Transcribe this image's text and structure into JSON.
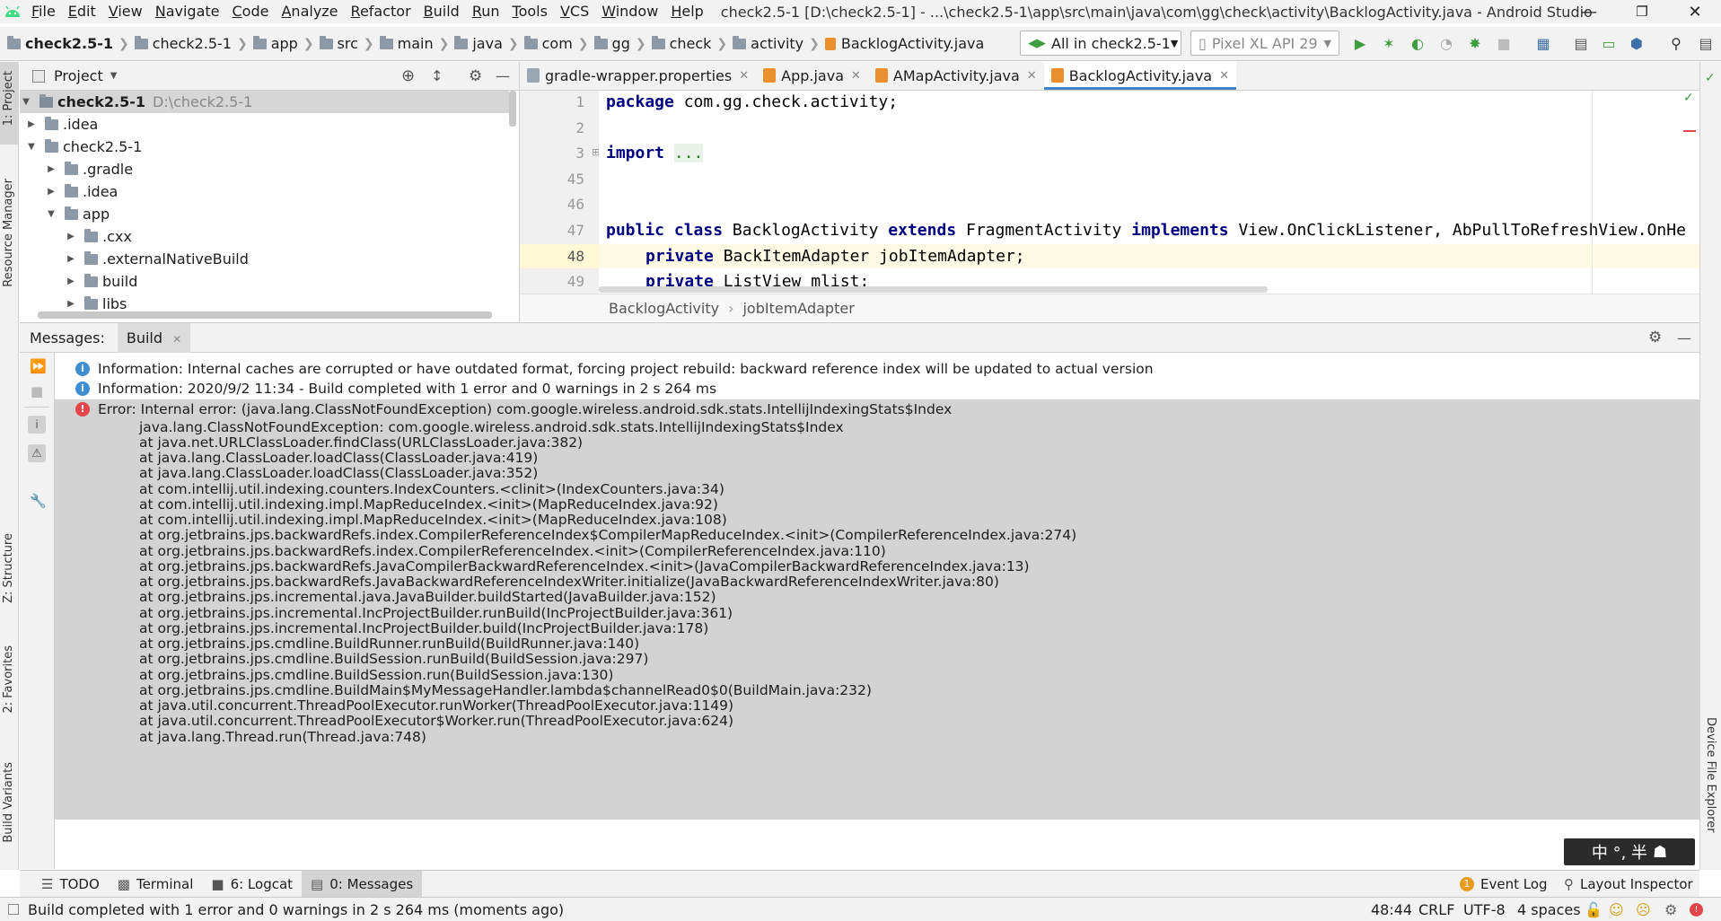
{
  "menubar": {
    "items": [
      "File",
      "Edit",
      "View",
      "Navigate",
      "Code",
      "Analyze",
      "Refactor",
      "Build",
      "Run",
      "Tools",
      "VCS",
      "Window",
      "Help"
    ],
    "window_title": "check2.5-1 [D:\\check2.5-1] - ...\\check2.5-1\\app\\src\\main\\java\\com\\gg\\check\\activity\\BacklogActivity.java - Android Studio"
  },
  "navbar": {
    "crumbs": [
      "check2.5-1",
      "check2.5-1",
      "app",
      "src",
      "main",
      "java",
      "com",
      "gg",
      "check",
      "activity",
      "BacklogActivity.java"
    ],
    "run_config": "All in check2.5-1",
    "device": "Pixel XL API 29"
  },
  "left_strip": {
    "project": "1: Project",
    "resource_manager": "Resource Manager",
    "structure": "Z: Structure",
    "favorites": "2: Favorites",
    "build_variants": "Build Variants"
  },
  "right_strip": {
    "device_file_explorer": "Device File Explorer"
  },
  "project_panel": {
    "title": "Project",
    "root_name": "check2.5-1",
    "root_path": "D:\\check2.5-1",
    "items": [
      ".idea",
      "check2.5-1",
      ".gradle",
      ".idea",
      "app",
      ".cxx",
      ".externalNativeBuild",
      "build",
      "libs"
    ]
  },
  "editor": {
    "tabs": [
      "gradle-wrapper.properties",
      "App.java",
      "AMapActivity.java",
      "BacklogActivity.java"
    ],
    "line_numbers": [
      "1",
      "2",
      "3",
      "45",
      "46",
      "47",
      "48",
      "49"
    ],
    "line1_kw": "package",
    "line1_rest": " com.gg.check.activity;",
    "line3_kw": "import",
    "line3_fold": "...",
    "line47_kw1": "public",
    "line47_kw2": "class",
    "line47_a": " BacklogActivity ",
    "line47_kw3": "extends",
    "line47_b": " FragmentActivity ",
    "line47_kw4": "implements",
    "line47_c": " View.OnClickListener, AbPullToRefreshView.OnHe",
    "line48_kw": "private",
    "line48_rest": " BackItemAdapter jobItemAdapter;",
    "line49_kw": "private",
    "line49_rest": " ListView mlist;",
    "breadcrumb_class": "BacklogActivity",
    "breadcrumb_member": "jobItemAdapter"
  },
  "messages": {
    "label": "Messages:",
    "tab": "Build",
    "info1": "Information: Internal caches are corrupted or have outdated format, forcing project rebuild: backward reference index will be updated to actual version",
    "info2": "Information: 2020/9/2 11:34 - Build completed with 1 error and 0 warnings in 2 s 264 ms",
    "error": "Error: Internal error: (java.lang.ClassNotFoundException) com.google.wireless.android.sdk.stats.IntellijIndexingStats$Index",
    "stack": [
      "java.lang.ClassNotFoundException: com.google.wireless.android.sdk.stats.IntellijIndexingStats$Index",
      "at java.net.URLClassLoader.findClass(URLClassLoader.java:382)",
      "at java.lang.ClassLoader.loadClass(ClassLoader.java:419)",
      "at java.lang.ClassLoader.loadClass(ClassLoader.java:352)",
      "at com.intellij.util.indexing.counters.IndexCounters.<clinit>(IndexCounters.java:34)",
      "at com.intellij.util.indexing.impl.MapReduceIndex.<init>(MapReduceIndex.java:92)",
      "at com.intellij.util.indexing.impl.MapReduceIndex.<init>(MapReduceIndex.java:108)",
      "at org.jetbrains.jps.backwardRefs.index.CompilerReferenceIndex$CompilerMapReduceIndex.<init>(CompilerReferenceIndex.java:274)",
      "at org.jetbrains.jps.backwardRefs.index.CompilerReferenceIndex.<init>(CompilerReferenceIndex.java:110)",
      "at org.jetbrains.jps.backwardRefs.JavaCompilerBackwardReferenceIndex.<init>(JavaCompilerBackwardReferenceIndex.java:13)",
      "at org.jetbrains.jps.backwardRefs.JavaBackwardReferenceIndexWriter.initialize(JavaBackwardReferenceIndexWriter.java:80)",
      "at org.jetbrains.jps.incremental.java.JavaBuilder.buildStarted(JavaBuilder.java:152)",
      "at org.jetbrains.jps.incremental.IncProjectBuilder.runBuild(IncProjectBuilder.java:361)",
      "at org.jetbrains.jps.incremental.IncProjectBuilder.build(IncProjectBuilder.java:178)",
      "at org.jetbrains.jps.cmdline.BuildRunner.runBuild(BuildRunner.java:140)",
      "at org.jetbrains.jps.cmdline.BuildSession.runBuild(BuildSession.java:297)",
      "at org.jetbrains.jps.cmdline.BuildSession.run(BuildSession.java:130)",
      "at org.jetbrains.jps.cmdline.BuildMain$MyMessageHandler.lambda$channelRead0$0(BuildMain.java:232)",
      "at java.util.concurrent.ThreadPoolExecutor.runWorker(ThreadPoolExecutor.java:1149)",
      "at java.util.concurrent.ThreadPoolExecutor$Worker.run(ThreadPoolExecutor.java:624)",
      "at java.lang.Thread.run(Thread.java:748)"
    ]
  },
  "bottom_tabs": {
    "todo": "TODO",
    "terminal": "Terminal",
    "logcat": "6: Logcat",
    "messages": "0: Messages",
    "event_log": "Event Log",
    "event_count": "1",
    "layout_inspector": "Layout Inspector"
  },
  "status": {
    "text": "Build completed with 1 error and 0 warnings in 2 s 264 ms (moments ago)",
    "position": "48:44",
    "line_sep": "CRLF",
    "encoding": "UTF-8",
    "indent": "4 spaces"
  },
  "ime": {
    "text": "中 °, 半"
  },
  "colors": {
    "accent": "#4083c9",
    "error": "#e0454a",
    "info": "#3d8fd1",
    "run_green": "#3f9c3f"
  }
}
